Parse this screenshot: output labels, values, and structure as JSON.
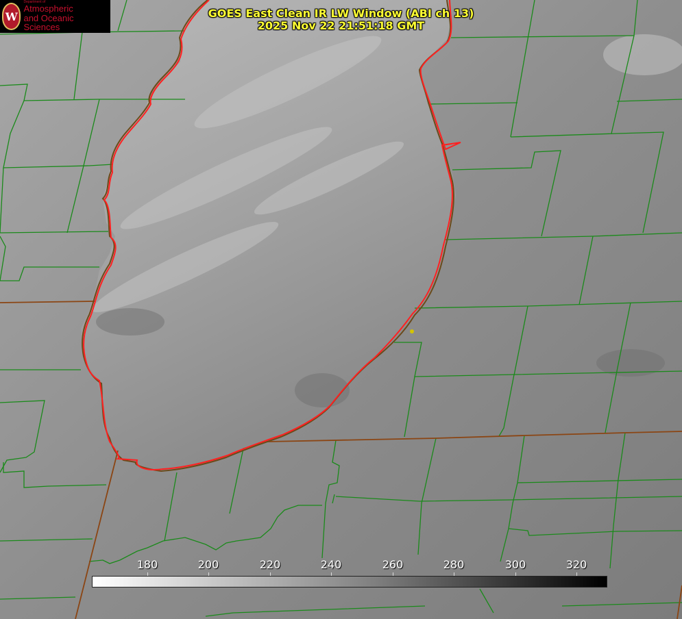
{
  "header": {
    "title_line1": "GOES East Clean IR LW Window (ABI ch 13)",
    "title_line2": "2025 Nov 22 21:51:18 GMT"
  },
  "logo": {
    "dept": "Department of",
    "line1": "Atmospheric",
    "line2": "and Oceanic Sciences",
    "seal_letter": "W"
  },
  "colorbar": {
    "ticks": [
      "180",
      "200",
      "220",
      "240",
      "260",
      "280",
      "300",
      "320"
    ],
    "colors": {
      "cold": "#ffffff",
      "warm": "#000000"
    }
  },
  "map": {
    "colors": {
      "county_lines": "#1a8a1a",
      "state_lines": "#8b4513",
      "lake_outline": "#ff2020",
      "station_marker": "#d4c400"
    }
  }
}
